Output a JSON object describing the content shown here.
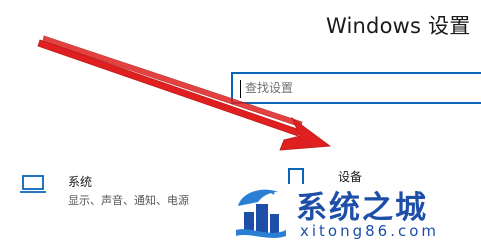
{
  "header": {
    "title": "Windows 设置"
  },
  "search": {
    "placeholder": "查找设置",
    "value": ""
  },
  "tiles": [
    {
      "title": "系统",
      "subtitle": "显示、声音、通知、电源",
      "icon": "laptop-icon"
    },
    {
      "title": "设备",
      "icon": "keyboard-icon"
    }
  ],
  "annotation": {
    "arrow_color": "#e02020"
  },
  "watermark": {
    "text": "系统之城",
    "url": "xitong86.com",
    "color": "#1d4fa8"
  }
}
